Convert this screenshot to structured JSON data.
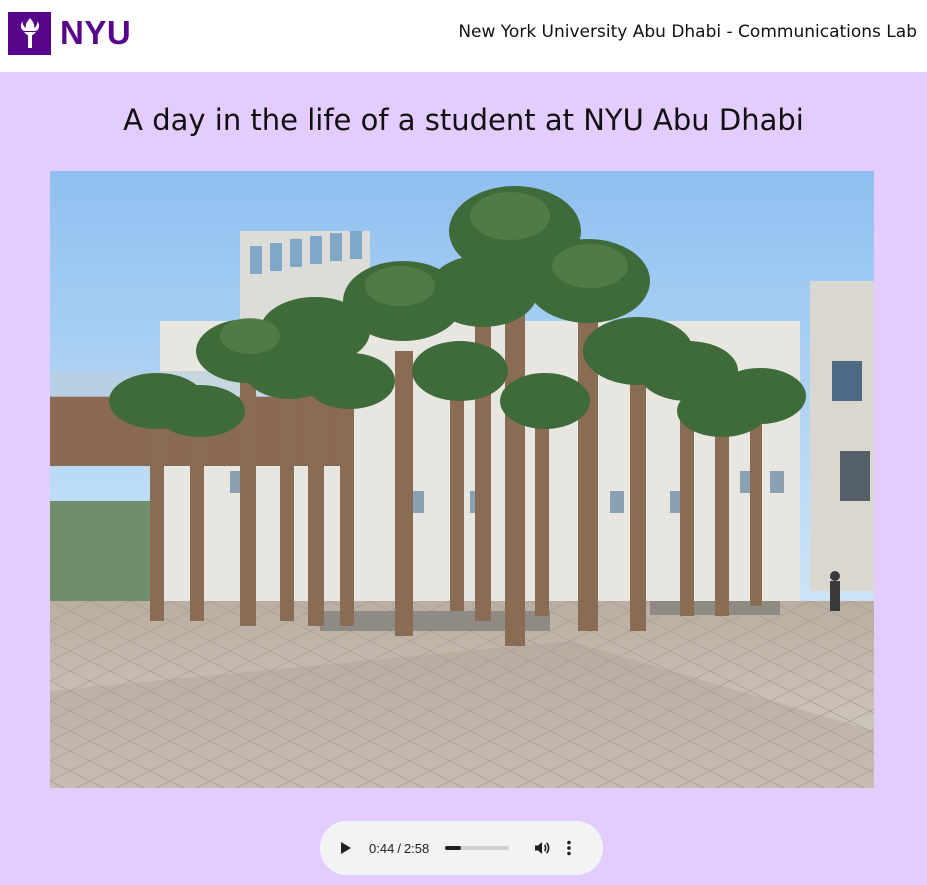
{
  "header": {
    "logo_text": "NYU",
    "logo_icon": "torch-icon",
    "title": "New York University Abu Dhabi - Communications Lab",
    "brand_color": "#57068c"
  },
  "main": {
    "heading": "A day in the life of a student at NYU Abu Dhabi",
    "background_color": "#e5ccff",
    "photo": {
      "subject": "campus plaza with palm trees",
      "icon": "photo-image"
    }
  },
  "audio_player": {
    "current_time": "0:44",
    "separator": "/",
    "duration": "2:58",
    "progress_fraction": 0.247,
    "play_icon": "play-icon",
    "volume_icon": "volume-icon",
    "menu_icon": "more-vert-icon"
  }
}
